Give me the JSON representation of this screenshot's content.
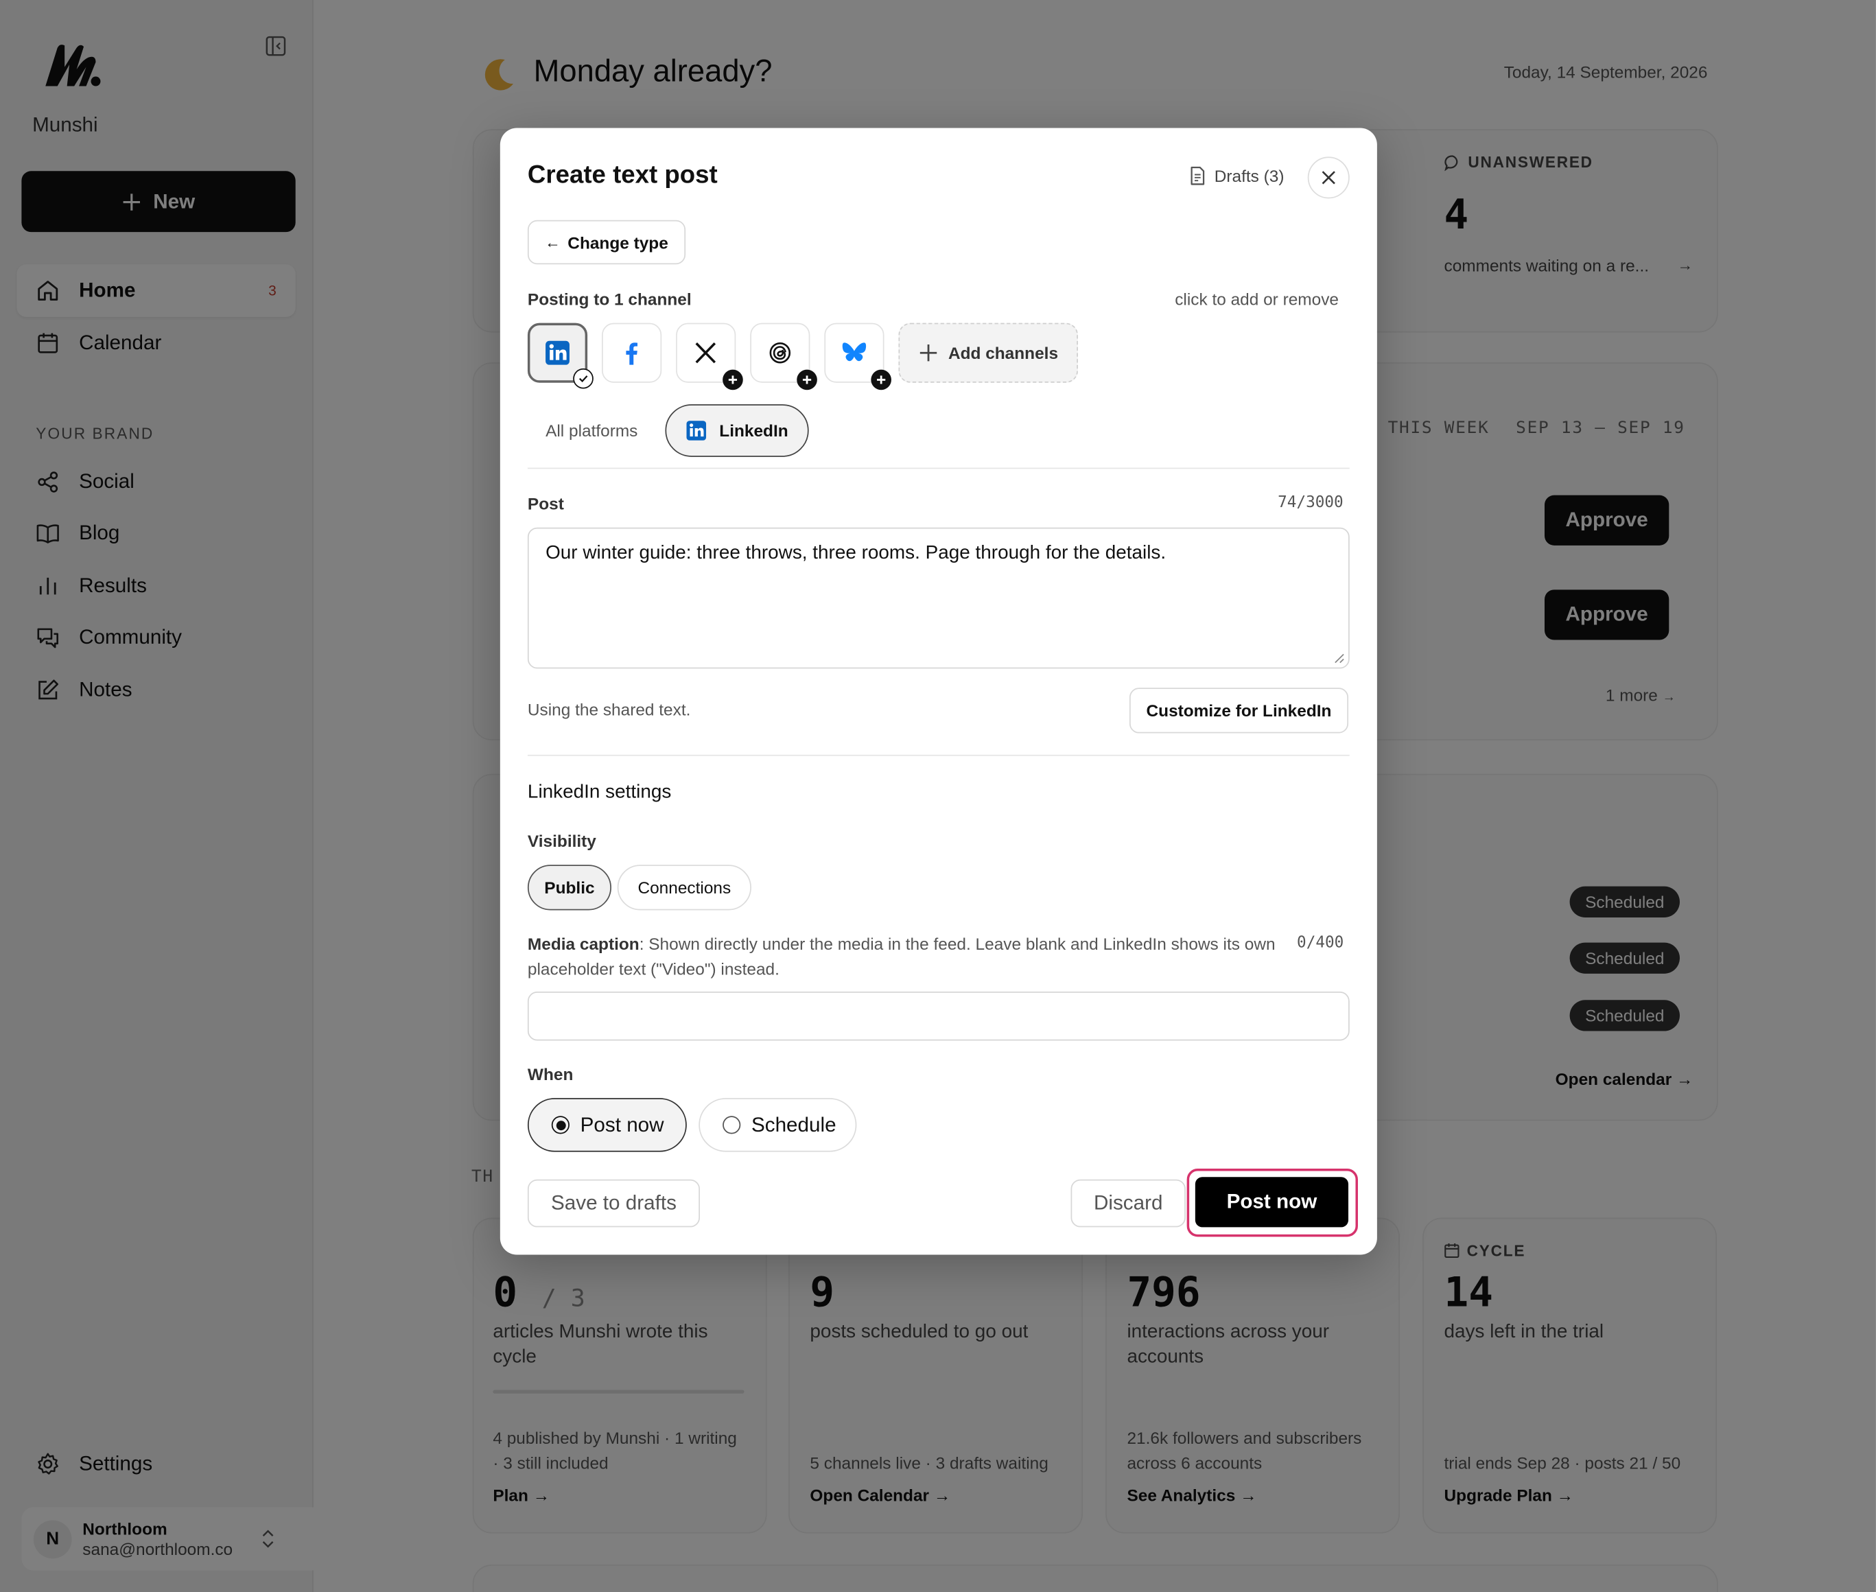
{
  "sidebar": {
    "brand_name": "Munshi",
    "new_button": "New",
    "nav": [
      {
        "label": "Home",
        "badge": "3"
      },
      {
        "label": "Calendar"
      }
    ],
    "section_label": "YOUR BRAND",
    "brand_nav": [
      {
        "label": "Social"
      },
      {
        "label": "Blog"
      },
      {
        "label": "Results"
      },
      {
        "label": "Community"
      },
      {
        "label": "Notes"
      }
    ],
    "settings": "Settings",
    "account": {
      "initial": "N",
      "name": "Northloom",
      "email": "sana@northloom.co"
    }
  },
  "dashboard": {
    "greeting": "Monday already?",
    "date": "Today, 14 September, 2026",
    "unanswered": {
      "label": "UNANSWERED",
      "value": "4",
      "text": "comments waiting on a re..."
    },
    "week": {
      "label": "THIS WEEK",
      "range": "SEP 13 – SEP 19",
      "approve": "Approve",
      "more": "1 more"
    },
    "scheduled": [
      "Scheduled",
      "Scheduled",
      "Scheduled"
    ],
    "open_calendar": "Open calendar →",
    "section_fragment": "TH",
    "stats": [
      {
        "value": "0",
        "suffix": "/ 3",
        "text": "articles Munshi wrote this cycle",
        "sub": "4 published by Munshi · 1 writing · 3 still included",
        "link": "Plan →"
      },
      {
        "value": "9",
        "text": "posts scheduled to go out",
        "sub": "5 channels live · 3 drafts waiting",
        "link": "Open Calendar →"
      },
      {
        "value": "796",
        "text": "interactions across your accounts",
        "sub": "21.6k followers and subscribers across 6 accounts",
        "link": "See Analytics →"
      },
      {
        "label": "CYCLE",
        "value": "14",
        "text": "days left in the trial",
        "sub": "trial ends Sep 28 · posts 21 / 50",
        "link": "Upgrade Plan →"
      }
    ]
  },
  "modal": {
    "title": "Create text post",
    "drafts": "Drafts (3)",
    "change_type": "Change type",
    "posting_to": "Posting to 1 channel",
    "click_hint": "click to add or remove",
    "channels": [
      {
        "icon": "linkedin-icon",
        "selected": true
      },
      {
        "icon": "facebook-icon",
        "selected": false
      },
      {
        "icon": "x-icon",
        "selected": false
      },
      {
        "icon": "threads-icon",
        "selected": false
      },
      {
        "icon": "bluesky-icon",
        "selected": false
      }
    ],
    "add_channels": "Add channels",
    "tabs": {
      "all": "All platforms",
      "linkedin": "LinkedIn"
    },
    "post_label": "Post",
    "post_count": "74/3000",
    "post_text": "Our winter guide: three throws, three rooms. Page through for the details.",
    "shared_hint": "Using the shared text.",
    "customize": "Customize for LinkedIn",
    "settings_title": "LinkedIn settings",
    "visibility_label": "Visibility",
    "visibility_options": [
      "Public",
      "Connections"
    ],
    "caption_label": "Media caption",
    "caption_desc": ": Shown directly under the media in the feed. Leave blank and LinkedIn shows its own placeholder text (\"Video\") instead.",
    "caption_count": "0/400",
    "caption_value": "",
    "when_label": "When",
    "when_options": [
      "Post now",
      "Schedule"
    ],
    "save_drafts": "Save to drafts",
    "discard": "Discard",
    "post_now": "Post now",
    "colors": {
      "linkedin": "#0A66C2",
      "facebook": "#1877F2",
      "bluesky": "#1185FE",
      "highlight": "#D6336C"
    }
  }
}
